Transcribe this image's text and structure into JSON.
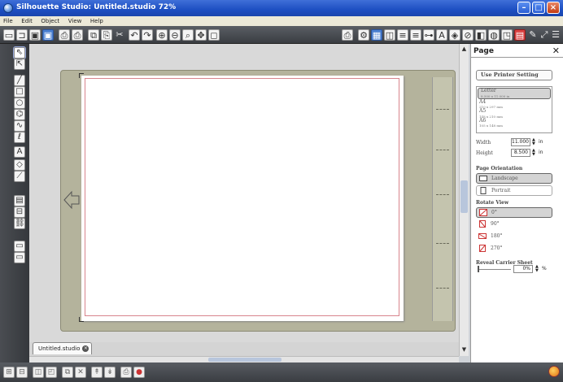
{
  "window": {
    "title": "Silhouette Studio: Untitled.studio 72%"
  },
  "menu": [
    "File",
    "Edit",
    "Object",
    "View",
    "Help"
  ],
  "doc_tab": {
    "label": "Untitled.studio"
  },
  "panel": {
    "title": "Page",
    "use_printer_setting": "Use Printer Setting",
    "sizes": [
      {
        "name": "Letter",
        "dims": "8.500 x 11.000 in"
      },
      {
        "name": "A4",
        "dims": "210 x 297 mm"
      },
      {
        "name": "A5",
        "dims": "148 x 210 mm"
      },
      {
        "name": "A6",
        "dims": "105 x 148 mm"
      }
    ],
    "width_label": "Width",
    "width_value": "11.000",
    "height_label": "Height",
    "height_value": "8.500",
    "unit": "in",
    "orientation_label": "Page Orientation",
    "orientations": [
      "Landscape",
      "Portrait"
    ],
    "rotate_label": "Rotate View",
    "rotations": [
      "0°",
      "90°",
      "180°",
      "270°"
    ],
    "reveal_label": "Reveal Carrier Sheet",
    "reveal_value": "0%",
    "reveal_unit": "%"
  },
  "icons": {
    "toolbar": [
      "new-icon",
      "open-icon",
      "save-icon",
      "save-as-icon",
      "print-icon",
      "cut-print-icon",
      "copy-icon",
      "paste-icon",
      "cut-icon",
      "undo-icon",
      "redo-icon",
      "zoom-in-icon",
      "zoom-out-icon",
      "zoom-select-icon",
      "pan-icon",
      "fit-page-icon"
    ],
    "left": [
      "select-icon",
      "edit-points-icon",
      "line-icon",
      "rectangle-icon",
      "ellipse-icon",
      "polygon-icon",
      "curve-icon",
      "freehand-icon",
      "text-icon",
      "eraser-icon",
      "knife-icon",
      "library-icon",
      "store-icon",
      "links-icon"
    ]
  }
}
